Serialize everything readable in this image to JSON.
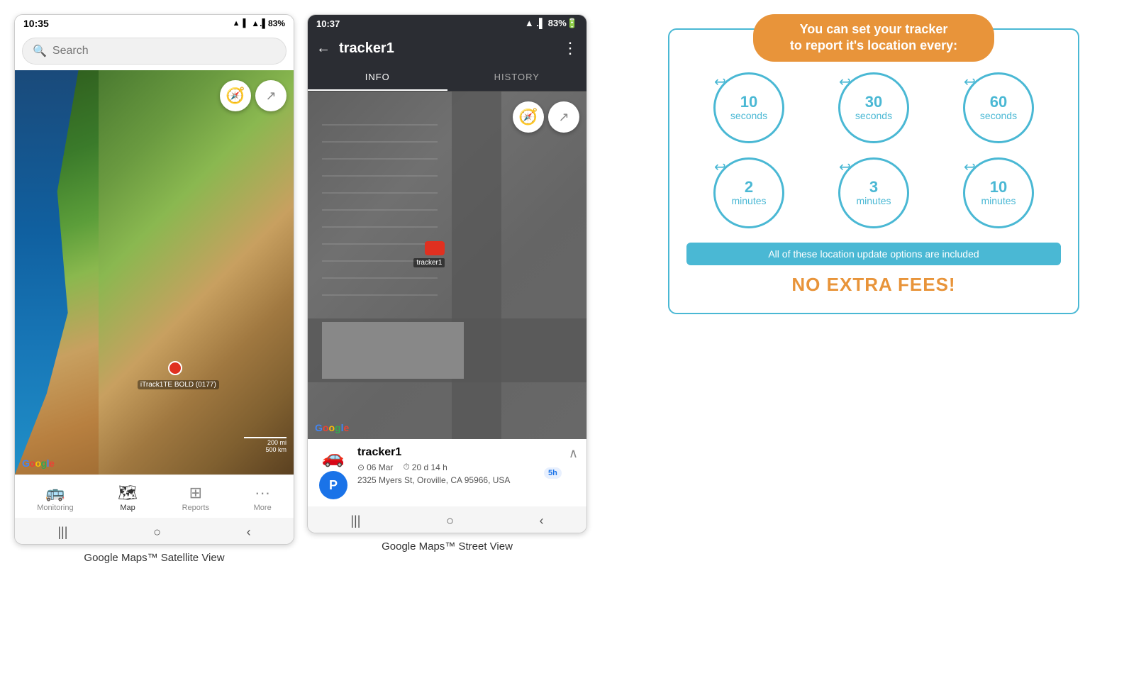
{
  "phone1": {
    "status_time": "10:35",
    "status_signal": "▲.▌83%",
    "search_placeholder": "Search",
    "map_type": "satellite",
    "google_label": "Google",
    "scale_mi": "200 mi",
    "scale_km": "500 km",
    "tracker_label": "iTrack1TE BOLD (0177)",
    "nav": {
      "items": [
        {
          "label": "Monitoring",
          "icon": "🚌",
          "active": false
        },
        {
          "label": "Map",
          "icon": "🗺",
          "active": true
        },
        {
          "label": "Reports",
          "icon": "⊞",
          "active": false
        },
        {
          "label": "More",
          "icon": "···",
          "active": false
        }
      ]
    },
    "caption": "Google Maps™ Satellite View"
  },
  "phone2": {
    "status_time": "10:37",
    "status_signal": "▲.▌83%",
    "tracker_name": "tracker1",
    "tab_info": "INFO",
    "tab_history": "HISTORY",
    "tracker_icon_letter": "P",
    "tracker_label_name": "tracker1",
    "meta_date": "06 Mar",
    "meta_duration": "20 d 14 h",
    "address": "2325 Myers St, Oroville, CA 95966, USA",
    "badge": "5h",
    "google_label": "Google",
    "street_label": "tracker1",
    "caption": "Google Maps™ Street View"
  },
  "info_panel": {
    "title_line1": "You can set your tracker",
    "title_line2": "to report it's location every:",
    "circles": [
      {
        "value": "10",
        "unit": "seconds"
      },
      {
        "value": "30",
        "unit": "seconds"
      },
      {
        "value": "60",
        "unit": "seconds"
      }
    ],
    "circles2": [
      {
        "value": "2",
        "unit": "minutes"
      },
      {
        "value": "3",
        "unit": "minutes"
      },
      {
        "value": "10",
        "unit": "minutes"
      }
    ],
    "banner_text": "All of these location update options are included",
    "no_extra_fees": "NO EXTRA FEES!"
  }
}
